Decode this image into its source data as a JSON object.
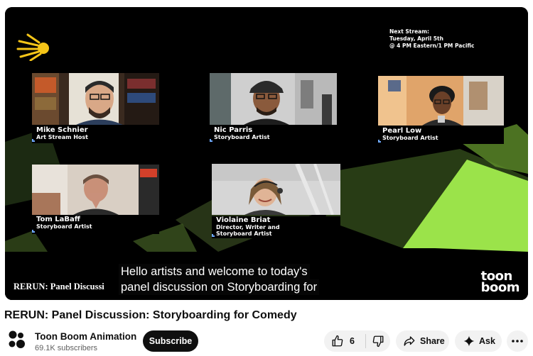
{
  "player": {
    "next_stream": [
      "Next Stream:",
      "Tuesday, April 5th",
      "@ 4 PM Eastern/1 PM Pacific"
    ],
    "participants": [
      {
        "name": "Mike Schnier",
        "role": "Art Stream Host"
      },
      {
        "name": "Nic Parris",
        "role": "Storyboard Artist"
      },
      {
        "name": "Pearl Low",
        "role": "Storyboard Artist"
      },
      {
        "name": "Tom LaBaff",
        "role": "Storyboard Artist"
      },
      {
        "name": "Violaine Briat",
        "role": "Director, Writer and",
        "role2": "Storyboard Artist"
      }
    ],
    "overlay_title": "RERUN: Panel Discussi",
    "captions": [
      "Hello artists and welcome to today's",
      "panel discussion on Storyboarding for"
    ],
    "watermark": [
      "toon",
      "boom"
    ]
  },
  "video": {
    "title": "RERUN: Panel Discussion: Storyboarding for Comedy"
  },
  "channel": {
    "name": "Toon Boom Animation",
    "subscribers": "69.1K subscribers",
    "subscribe_label": "Subscribe"
  },
  "actions": {
    "like_count": "6",
    "share_label": "Share",
    "ask_label": "Ask"
  },
  "colors": {
    "accent_green": "#9be34a",
    "logo_yellow": "#f5c518",
    "name_tick_blue": "#6fa9ff"
  },
  "icons": [
    "sunburst-logo-icon",
    "thumbs-up-icon",
    "thumbs-down-icon",
    "share-arrow-icon",
    "sparkle-icon",
    "more-dots-icon",
    "channel-avatar-icon"
  ]
}
